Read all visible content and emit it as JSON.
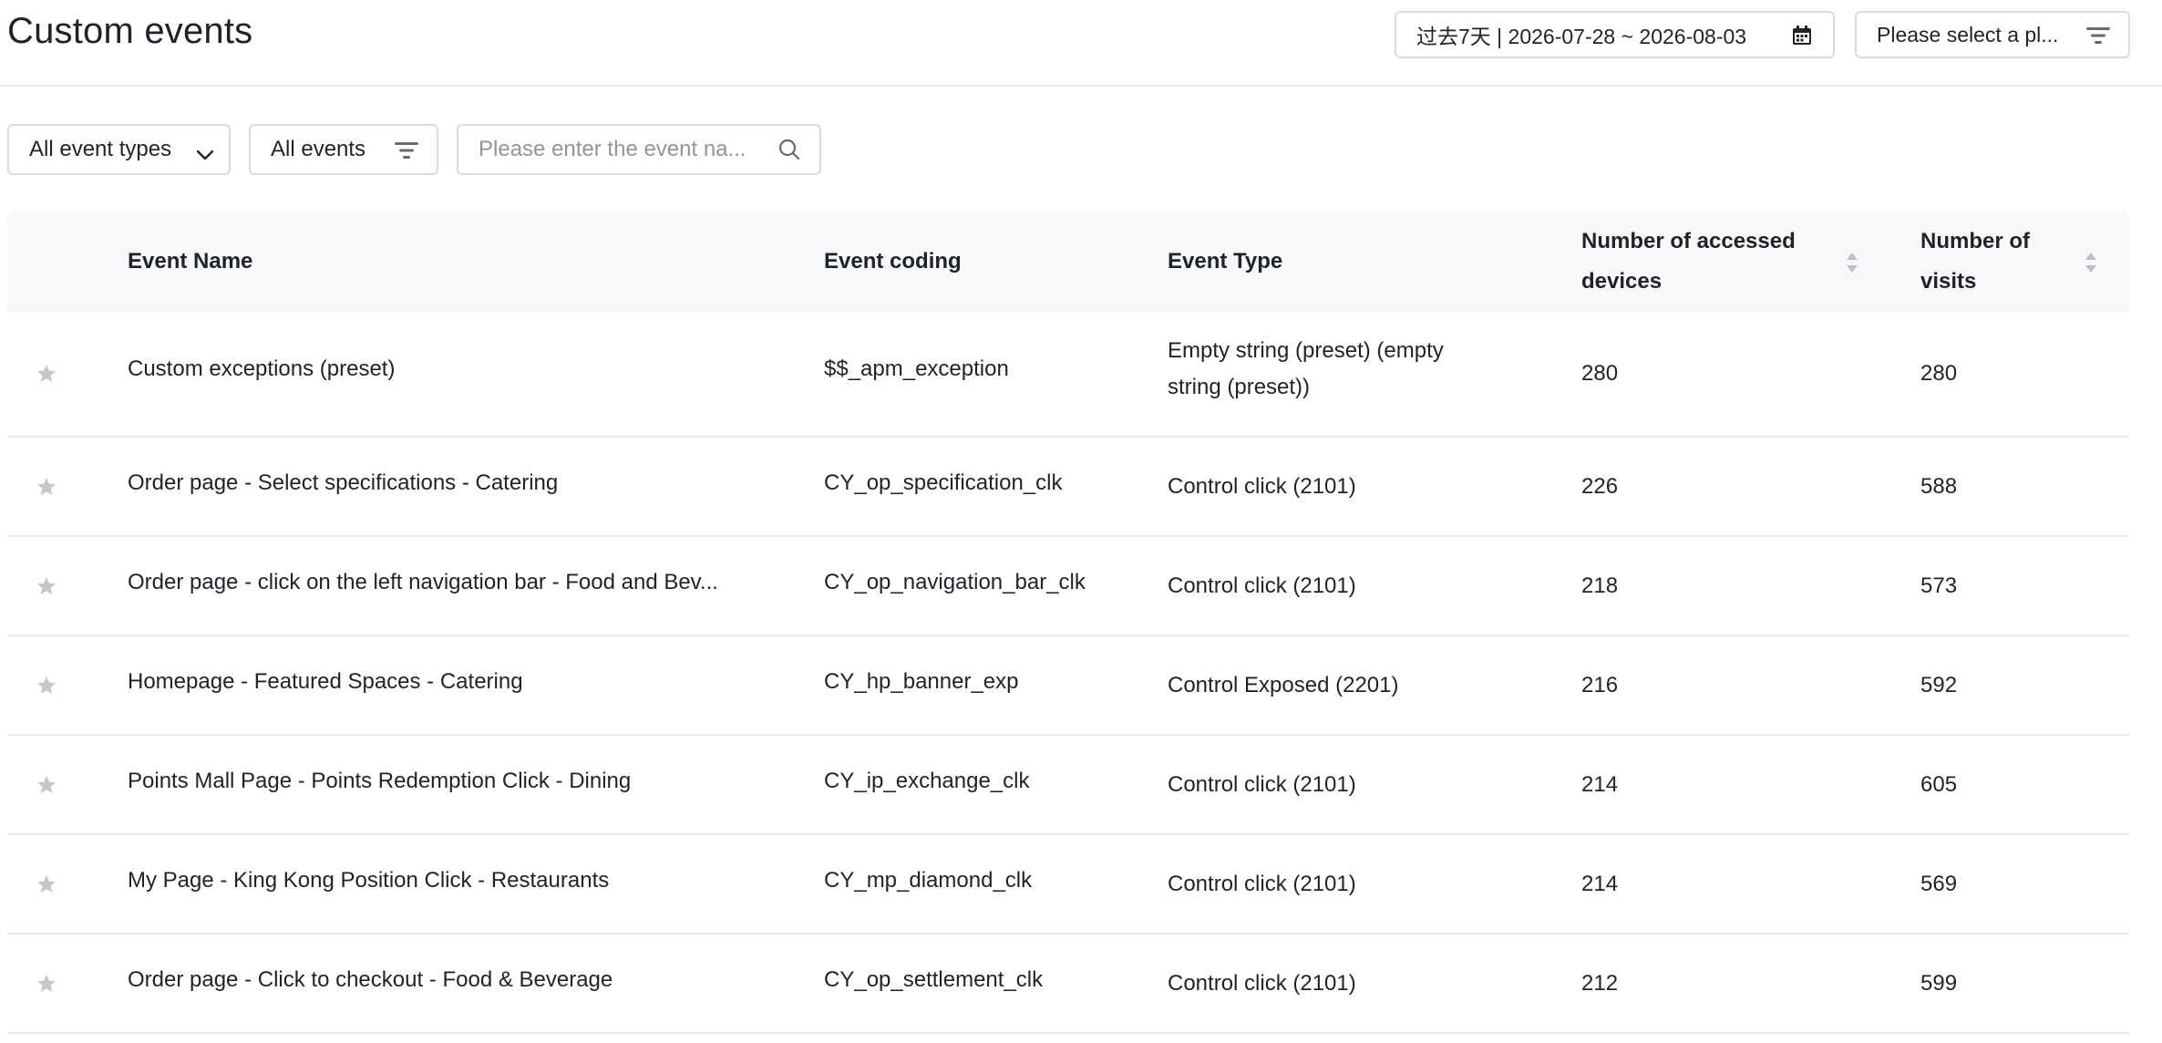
{
  "header": {
    "title": "Custom events",
    "date_range": "过去7天 | 2026-07-28 ~ 2026-08-03",
    "platform_placeholder": "Please select a pl..."
  },
  "filters": {
    "event_types": "All event types",
    "events": "All events",
    "search_placeholder": "Please enter the event na..."
  },
  "table": {
    "columns": {
      "name": "Event Name",
      "coding": "Event coding",
      "type": "Event Type",
      "devices_line1": "Number of accessed",
      "devices_line2": "devices",
      "visits_line1": "Number of",
      "visits_line2": "visits"
    },
    "rows": [
      {
        "name": "Custom exceptions (preset)",
        "coding": "$$_apm_exception",
        "type_line1": "Empty string (preset) (empty",
        "type_line2": "string (preset))",
        "devices": "280",
        "visits": "280"
      },
      {
        "name": "Order page - Select specifications - Catering",
        "coding": "CY_op_specification_clk",
        "type": "Control click (2101)",
        "devices": "226",
        "visits": "588"
      },
      {
        "name": "Order page - click on the left navigation bar - Food and Bev...",
        "coding": "CY_op_navigation_bar_clk",
        "type": "Control click (2101)",
        "devices": "218",
        "visits": "573"
      },
      {
        "name": "Homepage - Featured Spaces - Catering",
        "coding": "CY_hp_banner_exp",
        "type": "Control Exposed (2201)",
        "devices": "216",
        "visits": "592"
      },
      {
        "name": "Points Mall Page - Points Redemption Click - Dining",
        "coding": "CY_ip_exchange_clk",
        "type": "Control click (2101)",
        "devices": "214",
        "visits": "605"
      },
      {
        "name": "My Page - King Kong Position Click - Restaurants",
        "coding": "CY_mp_diamond_clk",
        "type": "Control click (2101)",
        "devices": "214",
        "visits": "569"
      },
      {
        "name": "Order page - Click to checkout - Food & Beverage",
        "coding": "CY_op_settlement_clk",
        "type": "Control click (2101)",
        "devices": "212",
        "visits": "599"
      }
    ]
  },
  "icons": {
    "calendar": "calendar-icon",
    "filter": "filter-icon",
    "chevron": "chevron-down-icon",
    "search": "search-icon",
    "star": "star-icon",
    "sort": "sort-icon"
  },
  "colors": {
    "border": "#d9dbdf",
    "header_bg": "#f7f8fa",
    "star": "#c4c7cc",
    "placeholder": "#8f959e"
  }
}
